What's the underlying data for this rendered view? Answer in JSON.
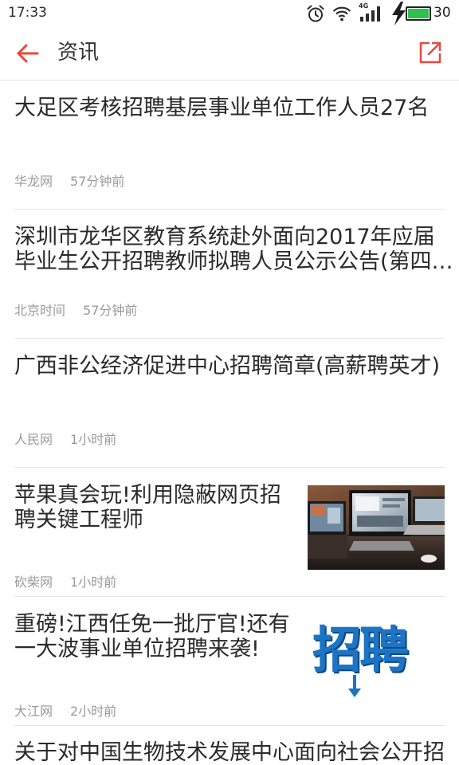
{
  "status_bar": {
    "time": "17:33",
    "network_type": "4G",
    "battery_level": "30",
    "icons": [
      "alarm-clock-icon",
      "wifi-icon",
      "signal-icon",
      "charging-icon",
      "battery-icon"
    ]
  },
  "header": {
    "title": "资讯",
    "back_icon": "arrow-left-icon",
    "share_icon": "external-link-icon"
  },
  "colors": {
    "accent": "#e8483c",
    "title_text": "#2a2a2a",
    "meta_text": "#9a9a9a",
    "divider": "#e6e6e6",
    "battery": "#2fc24a",
    "thumbnail_lettering": "#1c74c4"
  },
  "news": [
    {
      "title_lines": [
        "大足区考核招聘基层事业单位工作人员27名"
      ],
      "source": "华龙网",
      "time": "57分钟前"
    },
    {
      "title_lines": [
        "深圳市龙华区教育系统赴外面向2017年应届",
        "毕业生公开招聘教师拟聘人员公示公告(第四…"
      ],
      "source": "北京时间",
      "time": "57分钟前"
    },
    {
      "title_lines": [
        "广西非公经济促进中心招聘简章(高薪聘英才)"
      ],
      "source": "人民网",
      "time": "1小时前"
    },
    {
      "title_lines": [
        "苹果真会玩!利用隐蔽网页招",
        "聘关键工程师"
      ],
      "source": "砍柴网",
      "time": "1小时前"
    },
    {
      "title_lines": [
        "重磅!江西任免一批厅官!还有",
        "一大波事业单位招聘来袭!"
      ],
      "source": "大江网",
      "time": "2小时前",
      "thumbnail_text": "招聘"
    },
    {
      "title_lines": [
        "关于对中国生物技术发展中心面向社会公开招"
      ]
    }
  ]
}
